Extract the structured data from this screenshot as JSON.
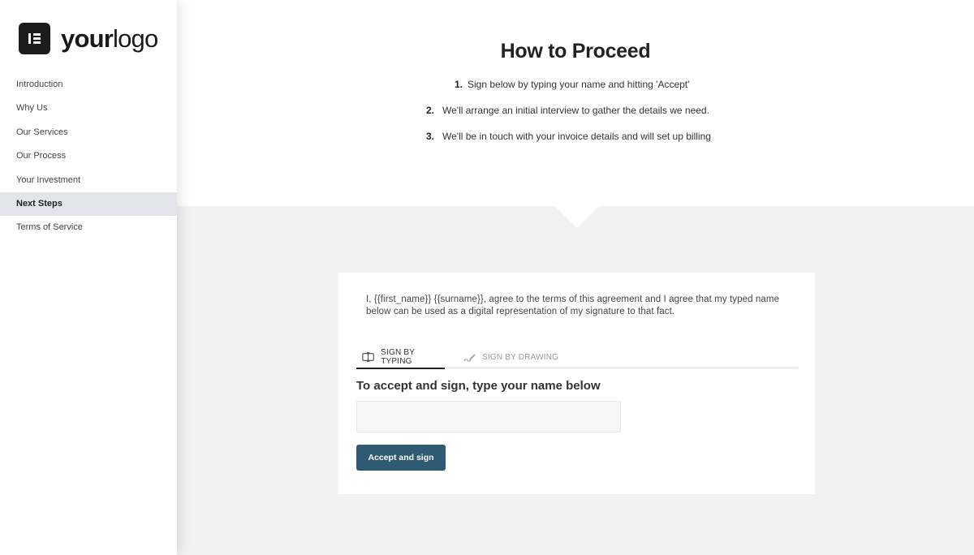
{
  "brand": {
    "logo_bold": "your",
    "logo_light": "logo",
    "logo_icon": "elementor-icon"
  },
  "sidebar": {
    "items": [
      {
        "label": "Introduction",
        "active": false
      },
      {
        "label": "Why Us",
        "active": false
      },
      {
        "label": "Our Services",
        "active": false
      },
      {
        "label": "Our Process",
        "active": false
      },
      {
        "label": "Your Investment",
        "active": false
      },
      {
        "label": "Next Steps",
        "active": true
      },
      {
        "label": "Terms of Service",
        "active": false
      }
    ]
  },
  "main": {
    "title": "How to Proceed",
    "steps": [
      {
        "num": "1.",
        "text": "Sign below by typing your name and hitting 'Accept'"
      },
      {
        "num": "2.",
        "text": "We'll arrange an initial interview to gather the details we need."
      },
      {
        "num": "3.",
        "text": "We'll be in touch with your invoice details and will set up billing"
      }
    ]
  },
  "signature": {
    "agreement": "I, {{first_name}} {{surname}}, agree to the terms of this agreement and I agree that my typed name below can be used as a digital representation of my signature to that fact.",
    "tabs": [
      {
        "label": "SIGN BY TYPING",
        "icon": "keyboard-icon",
        "active": true
      },
      {
        "label": "SIGN BY DRAWING",
        "icon": "pen-icon",
        "active": false
      }
    ],
    "heading": "To accept and sign, type your name below",
    "input_value": "",
    "input_placeholder": "",
    "button_label": "Accept and sign"
  },
  "colors": {
    "accent": "#2e5a73",
    "active_nav_bg": "#e2e4ea",
    "page_bg": "#f2f2f2"
  }
}
